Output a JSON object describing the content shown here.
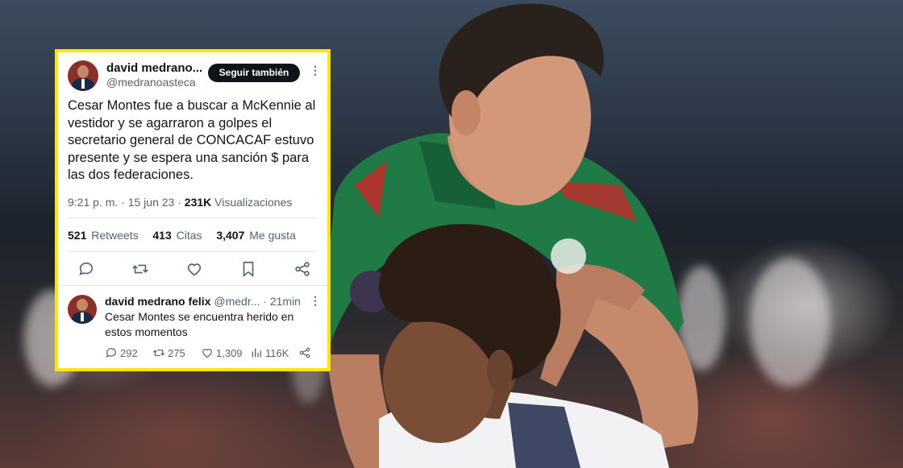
{
  "tweet": {
    "display_name": "david medrano...",
    "handle": "@medranoasteca",
    "follow_label": "Seguir también",
    "more_icon": "more-dots-icon",
    "text": "Cesar Montes fue a buscar a McKennie al vestidor y se agarraron a golpes el secretario general de CONCACAF estuvo presente y se espera una sanción $ para las dos federaciones.",
    "time": "9:21 p. m.",
    "date": "15 jun 23",
    "views_count": "231K",
    "views_label": "Visualizaciones",
    "retweets_count": "521",
    "retweets_label": "Retweets",
    "quotes_count": "413",
    "quotes_label": "Citas",
    "likes_count": "3,407",
    "likes_label": "Me gusta",
    "actions": [
      "reply-icon",
      "retweet-icon",
      "like-icon",
      "bookmark-icon",
      "share-icon"
    ]
  },
  "reply": {
    "display_name": "david medrano felix",
    "handle": "@medr...",
    "time": "· 21min",
    "text": "Cesar Montes se encuentra herido en estos momentos",
    "replies": "292",
    "retweets": "275",
    "likes": "1,309",
    "views": "116K"
  },
  "colors": {
    "frame": "#ffe600",
    "text": "#0f1419",
    "secondary": "#536471",
    "mexico_jersey": "#1f7a46",
    "usa_jersey": "#f2f2f4"
  }
}
